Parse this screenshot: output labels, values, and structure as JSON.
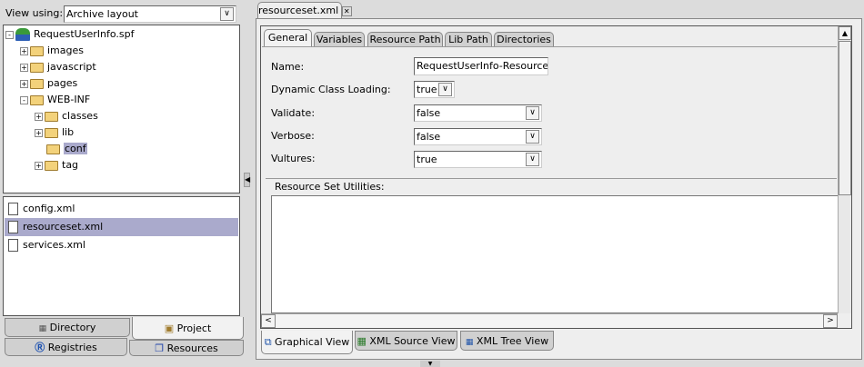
{
  "left": {
    "view_using_label": "View using:",
    "view_using_value": "Archive layout",
    "tree": [
      {
        "label": "RequestUserInfo.spf",
        "level": 0,
        "toggle": "-",
        "type": "project"
      },
      {
        "label": "images",
        "level": 1,
        "toggle": "+",
        "type": "folder"
      },
      {
        "label": "javascript",
        "level": 1,
        "toggle": "+",
        "type": "folder"
      },
      {
        "label": "pages",
        "level": 1,
        "toggle": "+",
        "type": "folder"
      },
      {
        "label": "WEB-INF",
        "level": 1,
        "toggle": "-",
        "type": "folder-open"
      },
      {
        "label": "classes",
        "level": 2,
        "toggle": "+",
        "type": "folder"
      },
      {
        "label": "lib",
        "level": 2,
        "toggle": "+",
        "type": "folder"
      },
      {
        "label": "conf",
        "level": 2,
        "toggle": "",
        "type": "folder-open",
        "selected": true
      },
      {
        "label": "tag",
        "level": 2,
        "toggle": "+",
        "type": "folder"
      }
    ],
    "files": [
      {
        "label": "config.xml"
      },
      {
        "label": "resourceset.xml",
        "selected": true
      },
      {
        "label": "services.xml"
      }
    ],
    "tabs": {
      "directory": "Directory",
      "project": "Project",
      "registries": "Registries",
      "resources": "Resources"
    }
  },
  "editor": {
    "file_tab": "resourceset.xml",
    "tabs": [
      "General",
      "Variables",
      "Resource Path",
      "Lib Path",
      "Directories"
    ],
    "form": {
      "name_label": "Name:",
      "name_value": "RequestUserInfo-ResourceSe",
      "dcl_label": "Dynamic Class Loading:",
      "dcl_value": "true",
      "validate_label": "Validate:",
      "validate_value": "false",
      "verbose_label": "Verbose:",
      "verbose_value": "false",
      "vultures_label": "Vultures:",
      "vultures_value": "true"
    },
    "utilities_label": "Resource Set Utilities:",
    "view_tabs": [
      "Graphical View",
      "XML Source View",
      "XML Tree View"
    ]
  },
  "colors": {
    "selection": "#aaaacc"
  }
}
